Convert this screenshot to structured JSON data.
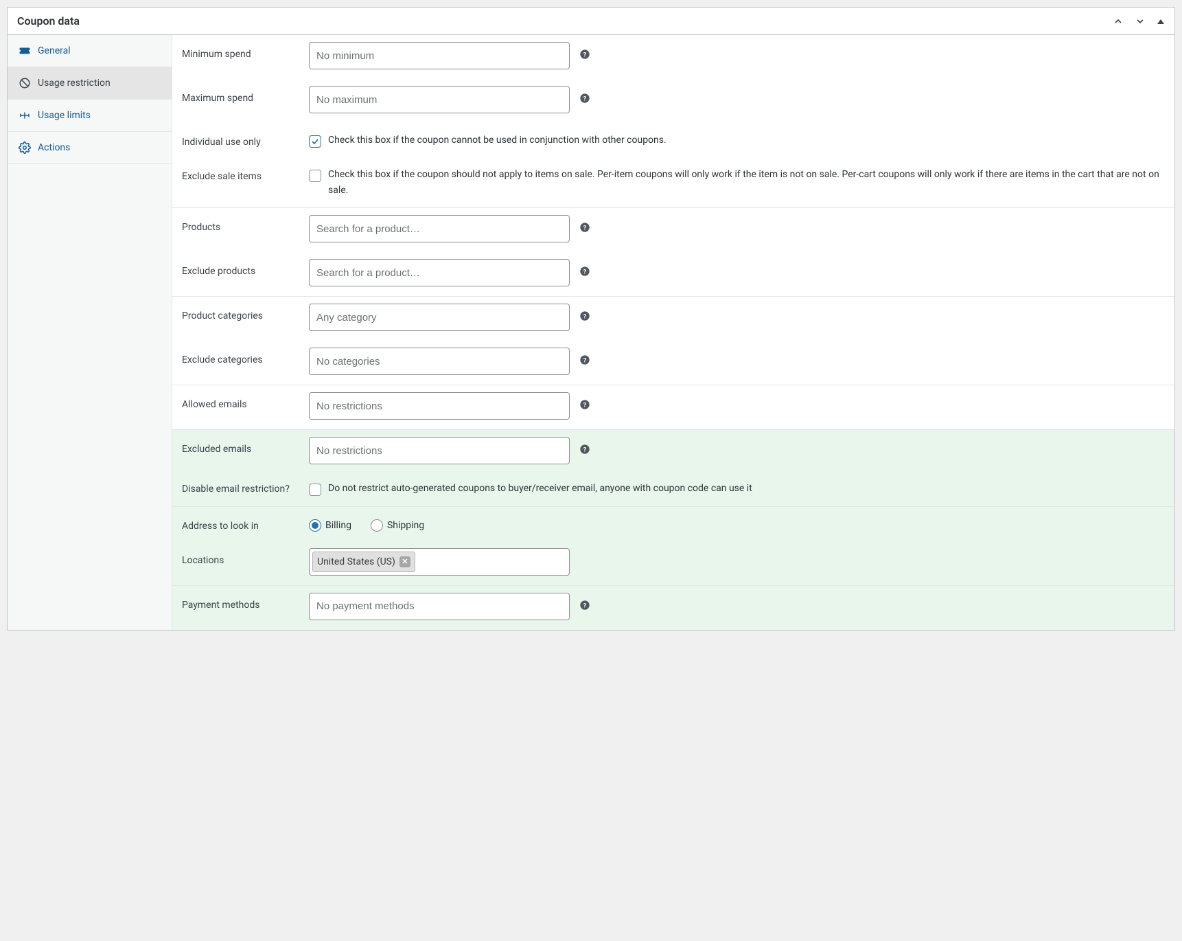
{
  "panel": {
    "title": "Coupon data"
  },
  "tabs": [
    {
      "name": "general",
      "label": "General"
    },
    {
      "name": "usage-restriction",
      "label": "Usage restriction"
    },
    {
      "name": "usage-limits",
      "label": "Usage limits"
    },
    {
      "name": "actions",
      "label": "Actions"
    }
  ],
  "fields": {
    "minimum_spend": {
      "label": "Minimum spend",
      "placeholder": "No minimum"
    },
    "maximum_spend": {
      "label": "Maximum spend",
      "placeholder": "No maximum"
    },
    "individual_use": {
      "label": "Individual use only",
      "desc": "Check this box if the coupon cannot be used in conjunction with other coupons.",
      "checked": true
    },
    "exclude_sale_items": {
      "label": "Exclude sale items",
      "desc": "Check this box if the coupon should not apply to items on sale. Per-item coupons will only work if the item is not on sale. Per-cart coupons will only work if there are items in the cart that are not on sale.",
      "checked": false
    },
    "products": {
      "label": "Products",
      "placeholder": "Search for a product…"
    },
    "exclude_products": {
      "label": "Exclude products",
      "placeholder": "Search for a product…"
    },
    "product_categories": {
      "label": "Product categories",
      "placeholder": "Any category"
    },
    "exclude_categories": {
      "label": "Exclude categories",
      "placeholder": "No categories"
    },
    "allowed_emails": {
      "label": "Allowed emails",
      "placeholder": "No restrictions"
    },
    "excluded_emails": {
      "label": "Excluded emails",
      "placeholder": "No restrictions"
    },
    "disable_email_restriction": {
      "label": "Disable email restriction?",
      "desc": "Do not restrict auto-generated coupons to buyer/receiver email, anyone with coupon code can use it",
      "checked": false
    },
    "address_to_look_in": {
      "label": "Address to look in",
      "options": {
        "billing": "Billing",
        "shipping": "Shipping"
      },
      "selected": "billing"
    },
    "locations": {
      "label": "Locations",
      "tags": [
        "United States (US)"
      ]
    },
    "payment_methods": {
      "label": "Payment methods",
      "placeholder": "No payment methods"
    }
  }
}
